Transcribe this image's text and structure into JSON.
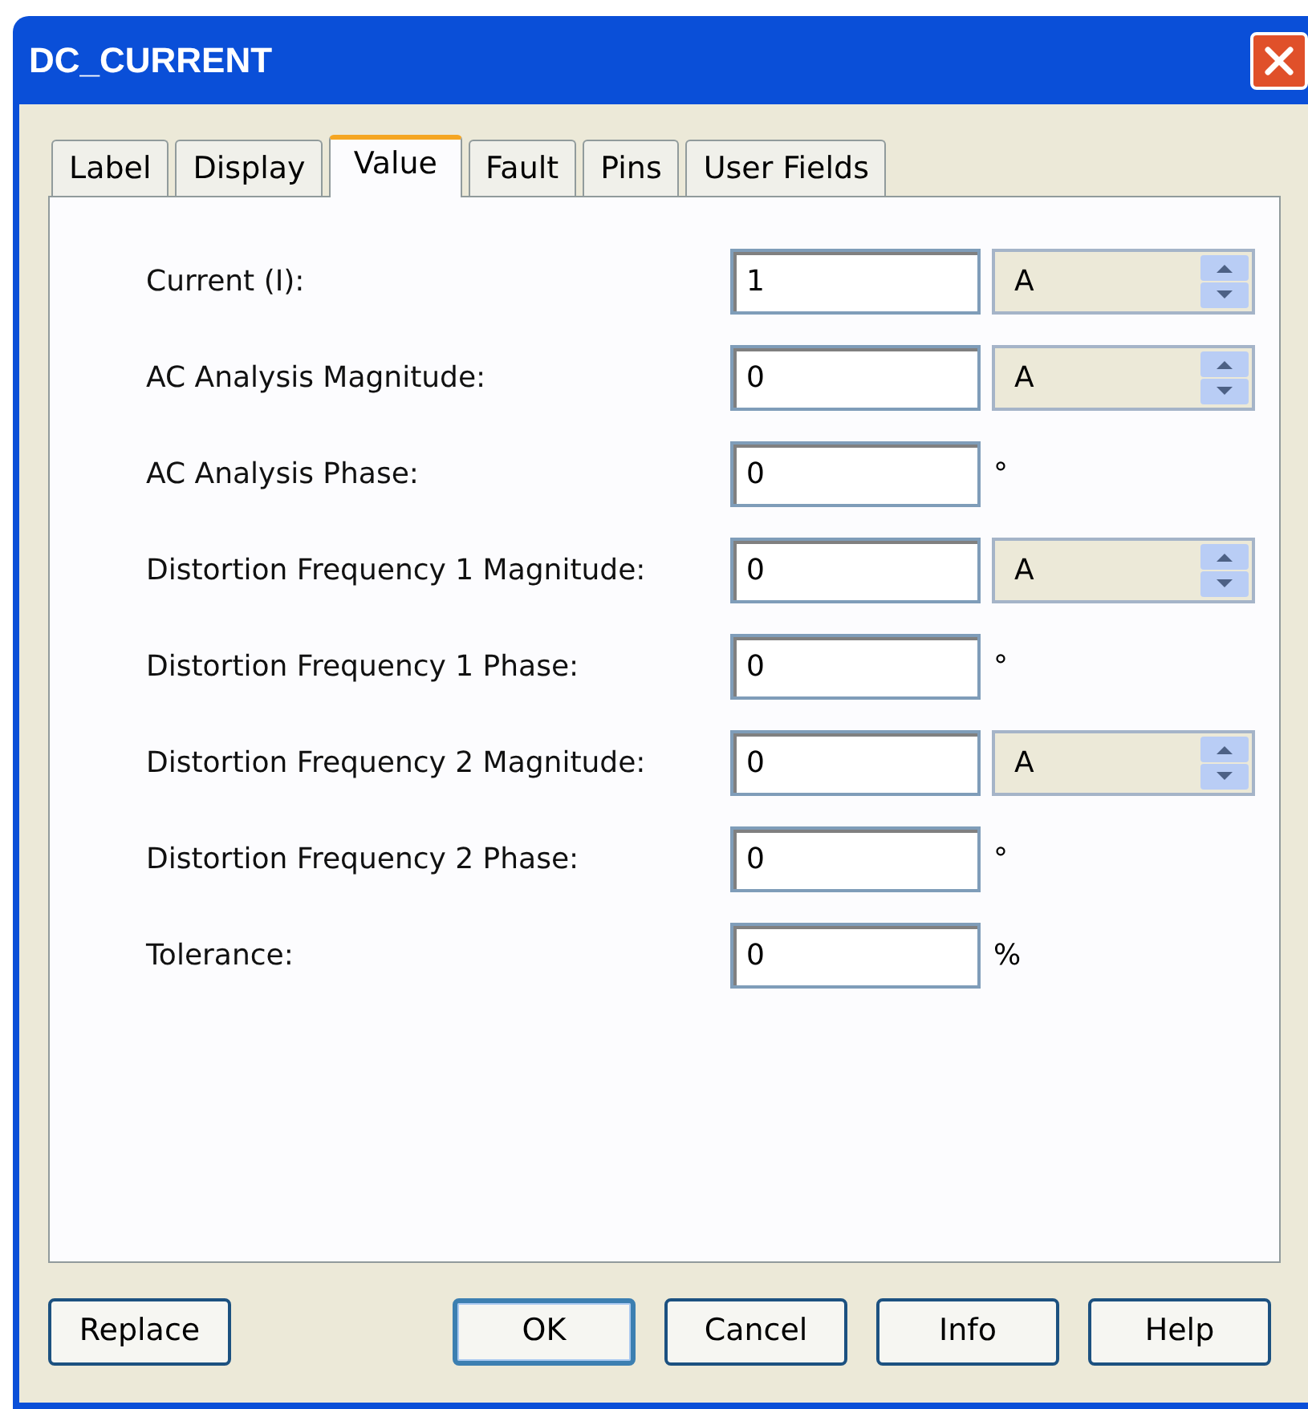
{
  "window": {
    "title": "DC_CURRENT"
  },
  "tabs": [
    {
      "label": "Label",
      "selected": false
    },
    {
      "label": "Display",
      "selected": false
    },
    {
      "label": "Value",
      "selected": true
    },
    {
      "label": "Fault",
      "selected": false
    },
    {
      "label": "Pins",
      "selected": false
    },
    {
      "label": "User Fields",
      "selected": false
    }
  ],
  "fields": [
    {
      "label": "Current (I):",
      "value": "1",
      "kind": "spinner",
      "unit": "A"
    },
    {
      "label": "AC Analysis Magnitude:",
      "value": "0",
      "kind": "spinner",
      "unit": "A"
    },
    {
      "label": "AC Analysis Phase:",
      "value": "0",
      "kind": "suffix",
      "unit": "°"
    },
    {
      "label": "Distortion Frequency 1 Magnitude:",
      "value": "0",
      "kind": "spinner",
      "unit": "A"
    },
    {
      "label": "Distortion Frequency 1 Phase:",
      "value": "0",
      "kind": "suffix",
      "unit": "°"
    },
    {
      "label": "Distortion Frequency 2 Magnitude:",
      "value": "0",
      "kind": "spinner",
      "unit": "A"
    },
    {
      "label": "Distortion Frequency 2 Phase:",
      "value": "0",
      "kind": "suffix",
      "unit": "°"
    },
    {
      "label": "Tolerance:",
      "value": "0",
      "kind": "suffix",
      "unit": "%"
    }
  ],
  "buttons": [
    {
      "label": "Replace",
      "default": false
    },
    {
      "label": "OK",
      "default": true
    },
    {
      "label": "Cancel",
      "default": false
    },
    {
      "label": "Info",
      "default": false
    },
    {
      "label": "Help",
      "default": false
    }
  ]
}
